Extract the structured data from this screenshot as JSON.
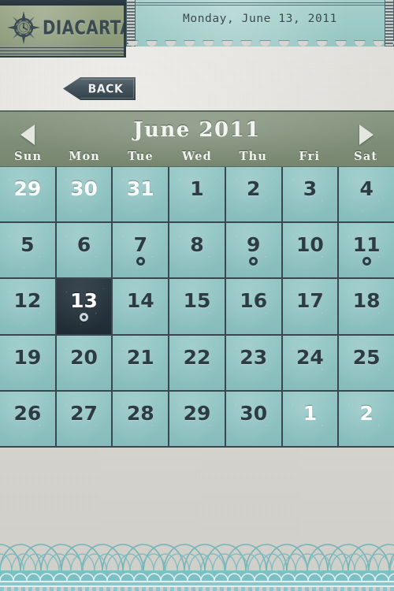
{
  "app": {
    "brand": "DIACARTA",
    "logo_icon": "compass-clock-icon"
  },
  "header": {
    "date_label": "Monday, June 13, 2011",
    "back_label": "BACK",
    "back_icon": "chevron-left-icon"
  },
  "calendar": {
    "month_title": "June 2011",
    "prev_icon": "triangle-left-icon",
    "next_icon": "triangle-right-icon",
    "weekdays": [
      "Sun",
      "Mon",
      "Tue",
      "Wed",
      "Thu",
      "Fri",
      "Sat"
    ],
    "selected_day": 13,
    "event_days": [
      7,
      9,
      11,
      13
    ],
    "days": [
      {
        "n": "29",
        "other": true,
        "event": false,
        "selected": false
      },
      {
        "n": "30",
        "other": true,
        "event": false,
        "selected": false
      },
      {
        "n": "31",
        "other": true,
        "event": false,
        "selected": false
      },
      {
        "n": "1",
        "other": false,
        "event": false,
        "selected": false
      },
      {
        "n": "2",
        "other": false,
        "event": false,
        "selected": false
      },
      {
        "n": "3",
        "other": false,
        "event": false,
        "selected": false
      },
      {
        "n": "4",
        "other": false,
        "event": false,
        "selected": false
      },
      {
        "n": "5",
        "other": false,
        "event": false,
        "selected": false
      },
      {
        "n": "6",
        "other": false,
        "event": false,
        "selected": false
      },
      {
        "n": "7",
        "other": false,
        "event": true,
        "selected": false
      },
      {
        "n": "8",
        "other": false,
        "event": false,
        "selected": false
      },
      {
        "n": "9",
        "other": false,
        "event": true,
        "selected": false
      },
      {
        "n": "10",
        "other": false,
        "event": false,
        "selected": false
      },
      {
        "n": "11",
        "other": false,
        "event": true,
        "selected": false
      },
      {
        "n": "12",
        "other": false,
        "event": false,
        "selected": false
      },
      {
        "n": "13",
        "other": false,
        "event": true,
        "selected": true
      },
      {
        "n": "14",
        "other": false,
        "event": false,
        "selected": false
      },
      {
        "n": "15",
        "other": false,
        "event": false,
        "selected": false
      },
      {
        "n": "16",
        "other": false,
        "event": false,
        "selected": false
      },
      {
        "n": "17",
        "other": false,
        "event": false,
        "selected": false
      },
      {
        "n": "18",
        "other": false,
        "event": false,
        "selected": false
      },
      {
        "n": "19",
        "other": false,
        "event": false,
        "selected": false
      },
      {
        "n": "20",
        "other": false,
        "event": false,
        "selected": false
      },
      {
        "n": "21",
        "other": false,
        "event": false,
        "selected": false
      },
      {
        "n": "22",
        "other": false,
        "event": false,
        "selected": false
      },
      {
        "n": "23",
        "other": false,
        "event": false,
        "selected": false
      },
      {
        "n": "24",
        "other": false,
        "event": false,
        "selected": false
      },
      {
        "n": "25",
        "other": false,
        "event": false,
        "selected": false
      },
      {
        "n": "26",
        "other": false,
        "event": false,
        "selected": false
      },
      {
        "n": "27",
        "other": false,
        "event": false,
        "selected": false
      },
      {
        "n": "28",
        "other": false,
        "event": false,
        "selected": false
      },
      {
        "n": "29",
        "other": false,
        "event": false,
        "selected": false
      },
      {
        "n": "30",
        "other": false,
        "event": false,
        "selected": false
      },
      {
        "n": "1",
        "other": true,
        "event": false,
        "selected": false
      },
      {
        "n": "2",
        "other": true,
        "event": false,
        "selected": false
      }
    ]
  },
  "decor": {
    "arch_pattern": "scalloped-arch-border"
  },
  "colors": {
    "cell_teal": "#8cc1c0",
    "grid_line": "#39474e",
    "header_sage": "#7e8d78",
    "logo_sage": "#8e9c7c",
    "ticket_teal": "#9ccac6",
    "selected_navy": "#25323b",
    "paper": "#d8d6d0",
    "decor_teal": "#6fb3b8"
  }
}
